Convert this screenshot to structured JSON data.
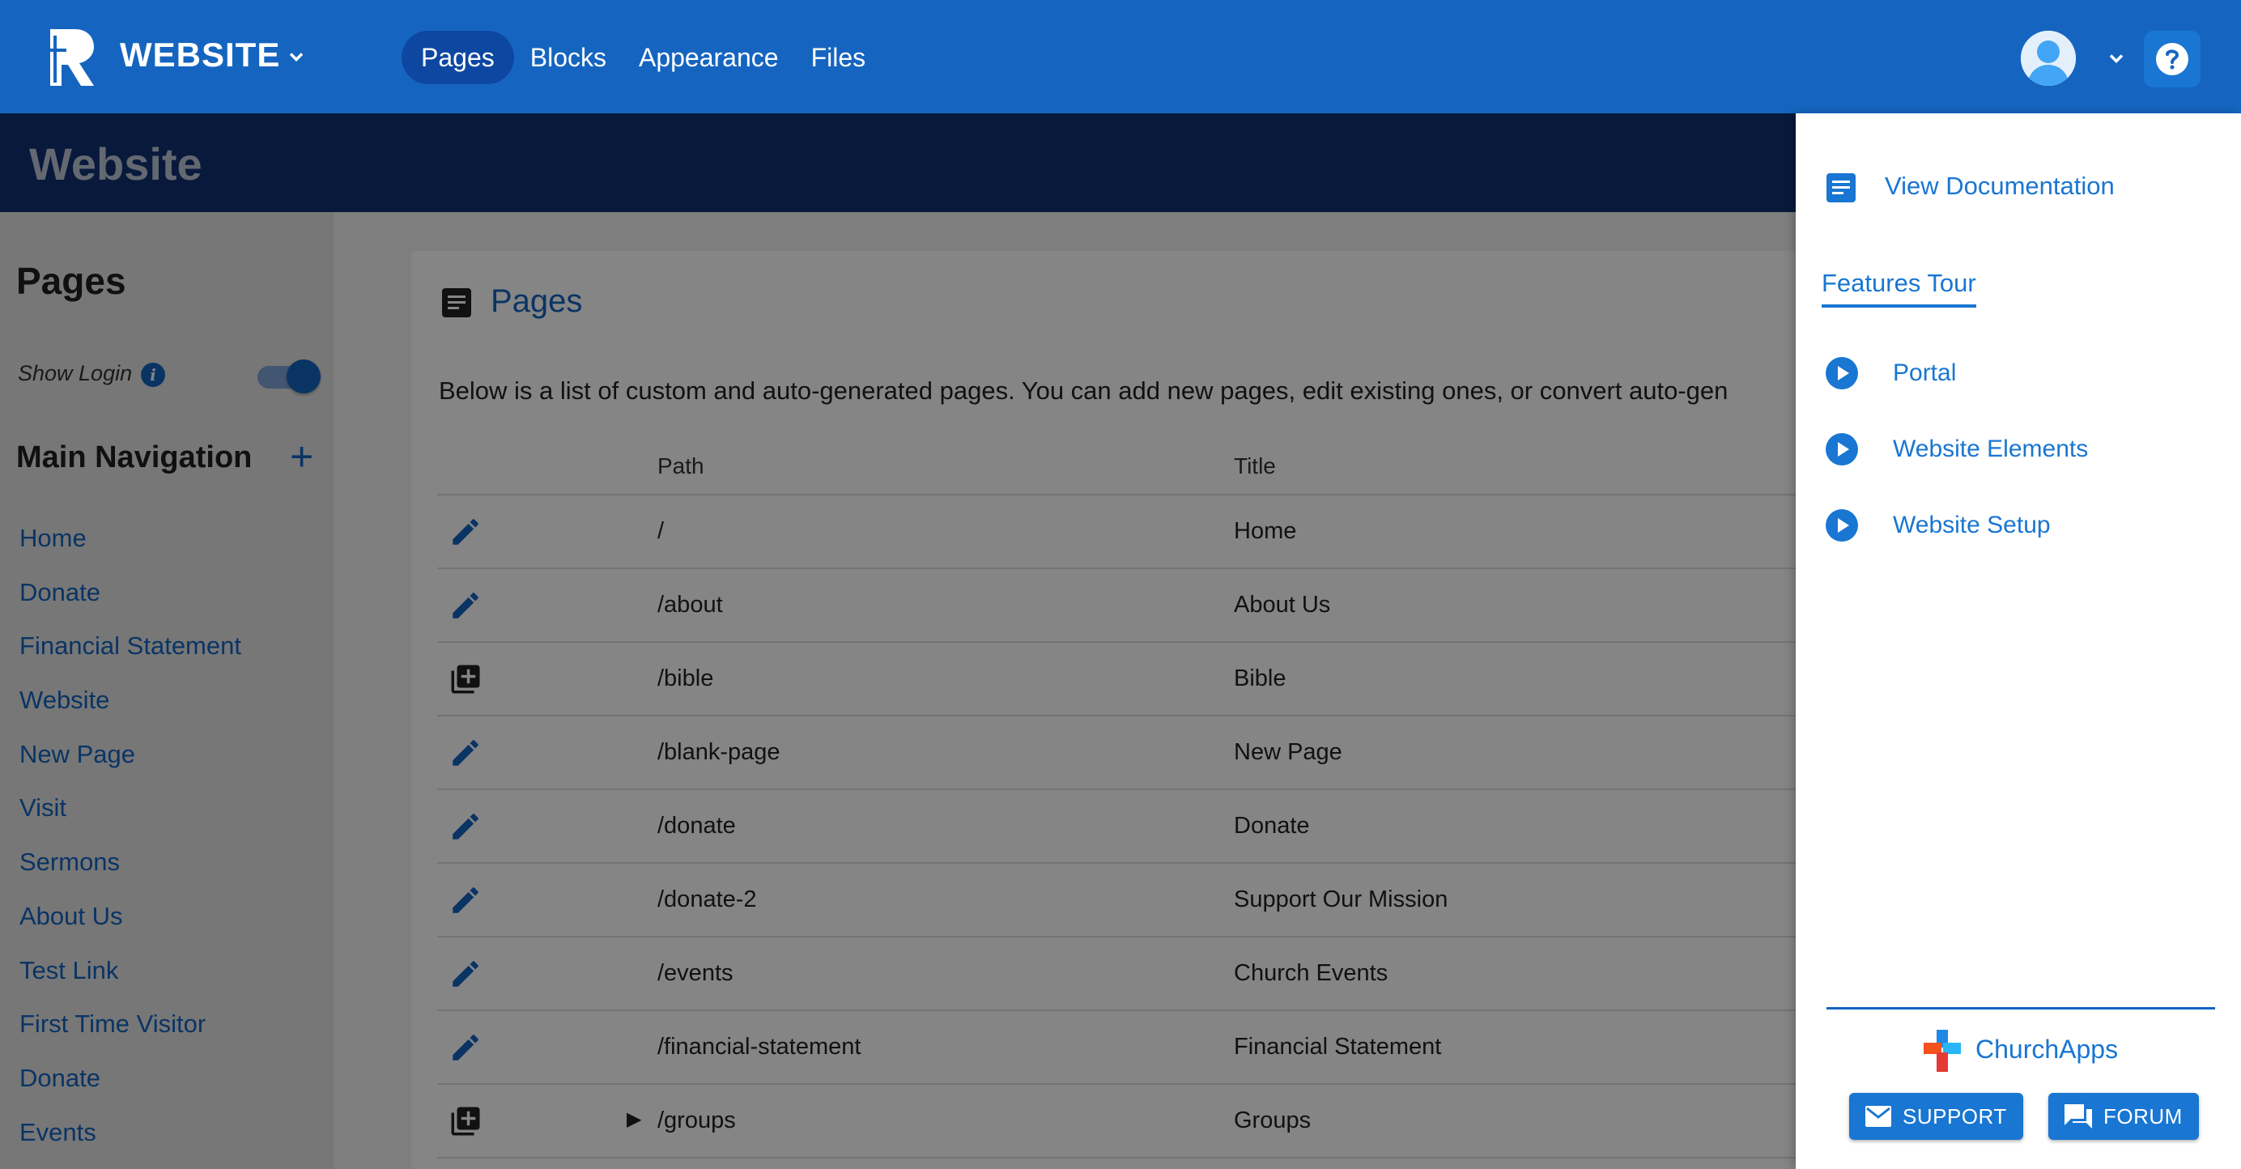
{
  "app": {
    "brand": "WEBSITE"
  },
  "nav": {
    "tabs": [
      "Pages",
      "Blocks",
      "Appearance",
      "Files"
    ]
  },
  "page_header": {
    "title": "Website"
  },
  "sidebar": {
    "title": "Pages",
    "show_login_label": "Show Login",
    "show_login": true,
    "nav_title": "Main Navigation",
    "items": [
      "Home",
      "Donate",
      "Financial Statement",
      "Website",
      "New Page",
      "Visit",
      "Sermons",
      "About Us",
      "Test Link",
      "First Time Visitor",
      "Donate",
      "Events"
    ]
  },
  "card": {
    "title": "Pages",
    "description": "Below is a list of custom and auto-generated pages. You can add new pages, edit existing ones, or convert auto-gen",
    "columns": {
      "path": "Path",
      "title": "Title"
    },
    "rows": [
      {
        "icon": "edit-icon",
        "path": "/",
        "title": "Home",
        "expand": ""
      },
      {
        "icon": "edit-icon",
        "path": "/about",
        "title": "About Us",
        "expand": ""
      },
      {
        "icon": "add-page-icon",
        "path": "/bible",
        "title": "Bible",
        "expand": ""
      },
      {
        "icon": "edit-icon",
        "path": "/blank-page",
        "title": "New Page",
        "expand": ""
      },
      {
        "icon": "edit-icon",
        "path": "/donate",
        "title": "Donate",
        "expand": ""
      },
      {
        "icon": "edit-icon",
        "path": "/donate-2",
        "title": "Support Our Mission",
        "expand": ""
      },
      {
        "icon": "edit-icon",
        "path": "/events",
        "title": "Church Events",
        "expand": ""
      },
      {
        "icon": "edit-icon",
        "path": "/financial-statement",
        "title": "Financial Statement",
        "expand": ""
      },
      {
        "icon": "add-page-icon",
        "path": "/groups",
        "title": "Groups",
        "expand": "▶"
      }
    ]
  },
  "help_drawer": {
    "view_docs": "View Documentation",
    "features_tour": "Features Tour",
    "tours": [
      "Portal",
      "Website Elements",
      "Website Setup"
    ],
    "brand": "ChurchApps",
    "support_label": "SUPPORT",
    "forum_label": "FORUM"
  },
  "colors": {
    "primary": "#1565C0",
    "header": "#103074",
    "link": "#1976D2"
  }
}
